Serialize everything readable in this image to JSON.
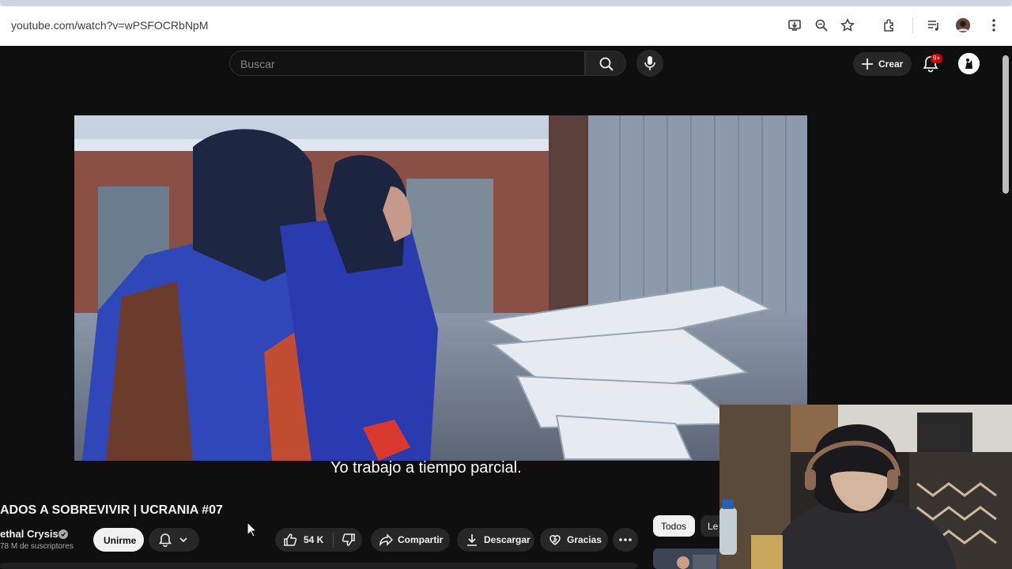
{
  "browser": {
    "url": "youtube.com/watch?v=wPSFOCRbNpM",
    "toolbar_icons": [
      "install-app-icon",
      "zoom-icon",
      "bookmark-star-icon",
      "extensions-icon",
      "media-controls-icon",
      "profile-avatar",
      "kebab-menu-icon"
    ]
  },
  "youtube": {
    "search_placeholder": "Buscar",
    "create_label": "Crear",
    "notifications_badge": "9+"
  },
  "video": {
    "subtitle": "Yo trabajo a tiempo parcial.",
    "title": "ADOS A SOBREVIVIR | UCRANIA #07"
  },
  "channel": {
    "name": "ethal Crysis",
    "subscribers": "78 M de suscriptores",
    "join_label": "Unirme"
  },
  "actions": {
    "likes": "54 K",
    "share": "Compartir",
    "download": "Descargar",
    "thanks": "Gracias"
  },
  "related": {
    "chip_all": "Todos",
    "chip_other": "Le"
  },
  "colors": {
    "yt_background": "#0f0f0f",
    "pill": "#272727",
    "badge": "#cc0000"
  }
}
